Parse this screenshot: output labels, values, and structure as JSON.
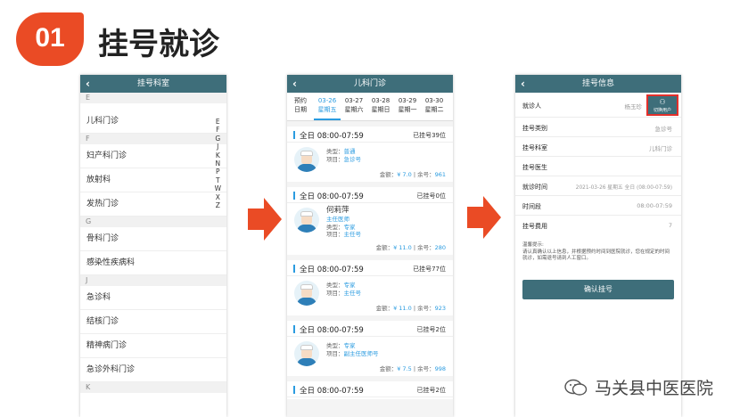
{
  "section": {
    "number": "01",
    "title": "挂号就诊"
  },
  "dept_screen": {
    "title": "挂号科室",
    "groups": [
      {
        "letter": "E",
        "items": [
          "儿科门诊"
        ]
      },
      {
        "letter": "F",
        "items": [
          "妇产科门诊",
          "放射科",
          "发热门诊"
        ]
      },
      {
        "letter": "G",
        "items": [
          "骨科门诊",
          "感染性疾病科"
        ]
      },
      {
        "letter": "J",
        "items": [
          "急诊科",
          "结核门诊",
          "精神病门诊",
          "急诊外科门诊"
        ]
      },
      {
        "letter": "K",
        "items": []
      }
    ],
    "alphabet": [
      "E",
      "F",
      "G",
      "J",
      "K",
      "N",
      "P",
      "T",
      "W",
      "X",
      "Z"
    ]
  },
  "schedule_screen": {
    "title": "儿科门诊",
    "dates": [
      {
        "top": "预约",
        "bottom": "日期"
      },
      {
        "top": "03-26",
        "bottom": "星期五"
      },
      {
        "top": "03-27",
        "bottom": "星期六"
      },
      {
        "top": "03-28",
        "bottom": "星期日"
      },
      {
        "top": "03-29",
        "bottom": "星期一"
      },
      {
        "top": "03-30",
        "bottom": "星期二"
      }
    ],
    "cards": [
      {
        "time": "全日 08:00-07:59",
        "remain": "已挂号39位",
        "name": "",
        "title": "",
        "type_label": "类型：",
        "type": "普通",
        "item_label": "项目：",
        "item": "急诊号",
        "fee_label": "金额：",
        "fee": "¥ 7.0",
        "left_label": "余号：",
        "left": "961"
      },
      {
        "time": "全日 08:00-07:59",
        "remain": "已挂号0位",
        "name": "何莉萍",
        "title": "主任医师",
        "type_label": "类型：",
        "type": "专家",
        "item_label": "项目：",
        "item": "主任号",
        "fee_label": "金额：",
        "fee": "¥ 11.0",
        "left_label": "余号：",
        "left": "280"
      },
      {
        "time": "全日 08:00-07:59",
        "remain": "已挂号77位",
        "name": "",
        "title": "",
        "type_label": "类型：",
        "type": "专家",
        "item_label": "项目：",
        "item": "主任号",
        "fee_label": "金额：",
        "fee": "¥ 11.0",
        "left_label": "余号：",
        "left": "923"
      },
      {
        "time": "全日 08:00-07:59",
        "remain": "已挂号2位",
        "name": "",
        "title": "",
        "type_label": "类型：",
        "type": "专家",
        "item_label": "项目：",
        "item": "副主任医师号",
        "fee_label": "金额：",
        "fee": "¥ 7.5",
        "left_label": "余号：",
        "left": "998"
      },
      {
        "time": "全日 08:00-07:59",
        "remain": "已挂号2位"
      }
    ]
  },
  "info_screen": {
    "title": "挂号信息",
    "switch_label": "切换用户",
    "rows": [
      {
        "label": "就诊人",
        "value": "杨玉珍"
      },
      {
        "label": "挂号类别",
        "value": "急诊号"
      },
      {
        "label": "挂号科室",
        "value": "儿科门诊"
      },
      {
        "label": "挂号医生",
        "value": ""
      },
      {
        "label": "就诊时间",
        "value": "2021-03-26 星期五 全日 (08:00-07:59)"
      },
      {
        "label": "时间段",
        "value": "08:00-07:59"
      },
      {
        "label": "挂号费用",
        "value": "7"
      }
    ],
    "tip_title": "温馨提示:",
    "tip_text": "请认真确认以上信息，并根据预约时间到医院就诊，您在规定的时间就诊，如需退号请到人工窗口。",
    "confirm": "确认挂号"
  },
  "watermark": "马关县中医医院",
  "colors": {
    "accent": "#ea4b25",
    "header": "#3e6e7a",
    "link": "#2a9be0"
  }
}
